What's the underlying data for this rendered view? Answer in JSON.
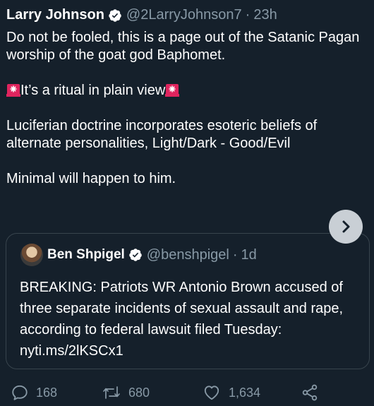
{
  "tweet": {
    "author_name": "Larry Johnson",
    "handle": "@2LarryJohnson7",
    "separator": "·",
    "time": "23h",
    "line1": "Do not be fooled, this is a page out of the Satanic Pagan worship of the goat god Baphomet.",
    "ritual_text": "It’s a ritual in plain view",
    "line3": "Luciferian doctrine incorporates esoteric beliefs of alternate personalities, Light/Dark - Good/Evil",
    "line4": "Minimal will happen to him."
  },
  "quoted_tweet": {
    "author_name": "Ben Shpigel",
    "handle": "@benshpigel",
    "separator": "·",
    "time": "1d",
    "text": "BREAKING: Patriots WR Antonio Brown accused of three separate incidents of sexual assault and rape, according to federal lawsuit filed Tuesday: nyti.ms/2lKSCx1"
  },
  "actions": {
    "reply_count": "168",
    "retweet_count": "680",
    "like_count": "1,634"
  },
  "icons": {
    "verified": "verified-badge-icon",
    "siren": "rotating-light-emoji",
    "next": "chevron-right-icon",
    "reply": "reply-icon",
    "retweet": "retweet-icon",
    "like": "heart-icon",
    "share": "share-icon"
  },
  "colors": {
    "background": "#15202b",
    "secondary_text": "#8899a6",
    "border": "#38444d",
    "siren_red": "#e0245e"
  }
}
